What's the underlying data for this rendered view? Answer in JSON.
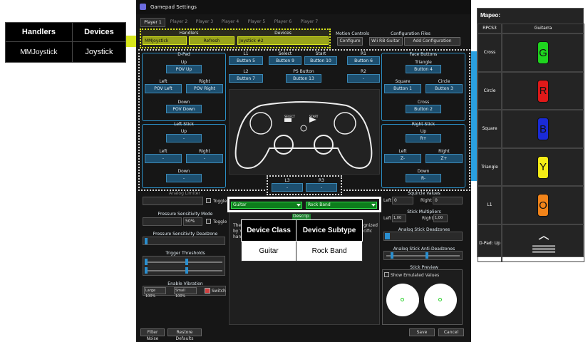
{
  "window": {
    "title": "Gamepad Settings",
    "tabs": [
      "Player 1",
      "Player 2",
      "Player 3",
      "Player 4",
      "Player 5",
      "Player 6",
      "Player 7"
    ]
  },
  "handlers": {
    "title": "Handlers",
    "value": "MMJoystick",
    "refresh": "Refresh"
  },
  "devices": {
    "title": "Devices",
    "value": "Joystick #2"
  },
  "motion": {
    "title": "Motion Controls",
    "button": "Configure"
  },
  "config": {
    "title": "Configuration Files",
    "value": "Wii RB Guitar",
    "button": "Add Configuration"
  },
  "dpad": {
    "title": "D-Pad",
    "up": "Up",
    "up_btn": "POV Up",
    "left": "Left",
    "left_btn": "POV Left",
    "right": "Right",
    "right_btn": "POV Right",
    "down": "Down",
    "down_btn": "POV Down"
  },
  "left_stick": {
    "title": "Left Stick",
    "up": "Up",
    "up_btn": "-",
    "left": "Left",
    "left_btn": "-",
    "right": "Right",
    "right_btn": "-",
    "down": "Down",
    "down_btn": "-"
  },
  "shoulders": {
    "l1": "L1",
    "l1_btn": "Button 5",
    "l2": "L2",
    "l2_btn": "Button 7",
    "r1": "R1",
    "r1_btn": "Button 6",
    "r2": "R2",
    "r2_btn": "-"
  },
  "center": {
    "select": "Select",
    "select_btn": "Button 9",
    "start": "Start",
    "start_btn": "Button 10",
    "ps": "PS Button",
    "ps_btn": "Button 13",
    "pad_select": "SELECT",
    "pad_start": "START"
  },
  "face": {
    "title": "Face Buttons",
    "triangle": "Triangle",
    "triangle_btn": "Button 4",
    "square": "Square",
    "square_btn": "Button 1",
    "circle": "Circle",
    "circle_btn": "Button 3",
    "cross": "Cross",
    "cross_btn": "Button 2"
  },
  "right_stick": {
    "title": "Right Stick",
    "up": "Up",
    "up_btn": "R+",
    "left": "Left",
    "left_btn": "Z-",
    "right": "Right",
    "right_btn": "Z+",
    "down": "Down",
    "down_btn": "R-"
  },
  "l3r3": {
    "l3": "L3",
    "l3_btn": "-",
    "r3": "R3",
    "r3_btn": "-"
  },
  "analog_limiter": {
    "title": "Analog Limiter",
    "toggle": "Toggle"
  },
  "pressure": {
    "title": "Pressure Sensitivity Mode",
    "value": "50%",
    "toggle": "Toggle",
    "deadzone": "Pressure Sensitivity Deadzone"
  },
  "trigger": {
    "title": "Trigger Thresholds"
  },
  "vibration": {
    "title": "Enable Vibration",
    "large": "Large 100%",
    "small": "Small 100%",
    "switch": "Switch"
  },
  "device_class": {
    "class_value": "Guitar",
    "subtype_value": "Rock Band",
    "desc_label": "Descrip",
    "desc_text_left": "The",
    "desc_text_left2": "by V",
    "desc_text_left3": "han",
    "desc_text_right": "gnized",
    "desc_text_right2": "cific"
  },
  "squircle": {
    "title": "Squircle Values",
    "left": "Left",
    "left_val": "0",
    "right": "Right",
    "right_val": "0"
  },
  "multipliers": {
    "title": "Stick Multipliers",
    "left": "Left",
    "left_val": "1,00",
    "right": "Right",
    "right_val": "1,00"
  },
  "deadzones": {
    "title": "Analog Stick Deadzones"
  },
  "anti_deadzones": {
    "title": "Analog Stick Anti-Deadzones"
  },
  "preview": {
    "title": "Stick Preview",
    "show": "Show Emulated Values"
  },
  "footer": {
    "filter": "Filter Noise",
    "restore": "Restore Defaults",
    "save": "Save",
    "cancel": "Cancel"
  },
  "left_table": {
    "headers": [
      "Handlers",
      "Devices"
    ],
    "values": [
      "MMJoystick",
      "Joystick"
    ]
  },
  "overlay_table": {
    "headers": [
      "Device Class",
      "Device Subtype"
    ],
    "values": [
      "Guitar",
      "Rock Band"
    ]
  },
  "mapeo": {
    "title": "Mapeo:",
    "col1": "RPCS3",
    "col2": "Guitarra",
    "rows": [
      {
        "label": "Cross",
        "letter": "G",
        "color": "#1fd41f"
      },
      {
        "label": "Circle",
        "letter": "R",
        "color": "#e01919"
      },
      {
        "label": "Square",
        "letter": "B",
        "color": "#1a2bd8"
      },
      {
        "label": "Triangle",
        "letter": "Y",
        "color": "#f4ec16"
      },
      {
        "label": "L1",
        "letter": "O",
        "color": "#f2841a"
      },
      {
        "label": "D-Pad: Up",
        "letter": "",
        "color": ""
      }
    ]
  }
}
